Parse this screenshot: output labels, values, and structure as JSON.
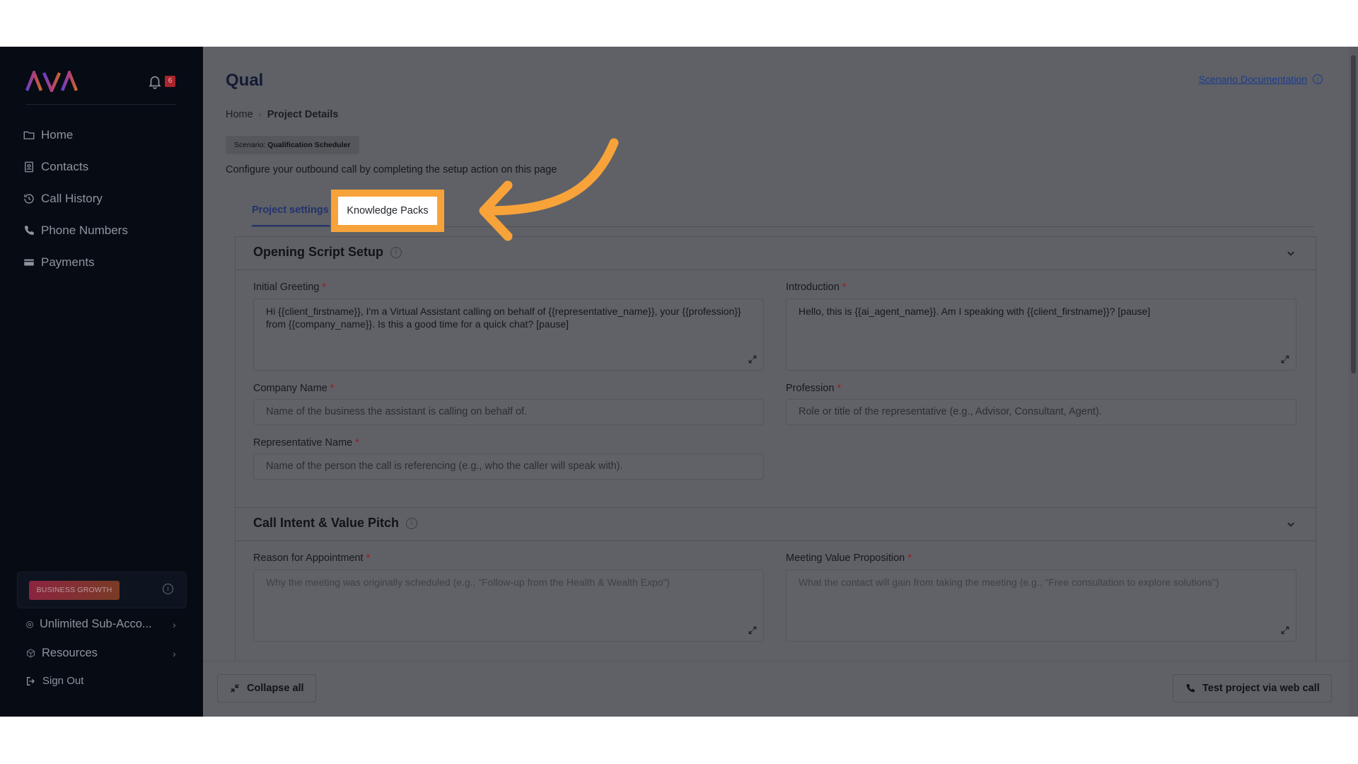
{
  "sidebar": {
    "brand": "AVA",
    "notification_count": "6",
    "nav": [
      {
        "label": "Home",
        "icon": "folder-icon"
      },
      {
        "label": "Contacts",
        "icon": "contacts-icon"
      },
      {
        "label": "Call History",
        "icon": "history-icon"
      },
      {
        "label": "Phone Numbers",
        "icon": "phone-icon"
      },
      {
        "label": "Payments",
        "icon": "card-icon"
      }
    ],
    "plan_badge": "BUSINESS GROWTH",
    "sub_account": "Unlimited Sub-Acco...",
    "resources": "Resources",
    "sign_out": "Sign Out"
  },
  "header": {
    "title": "Qual",
    "doc_link": "Scenario Documentation"
  },
  "breadcrumb": {
    "home": "Home",
    "current": "Project Details"
  },
  "scenario": {
    "prefix": "Scenario:",
    "name": "Qualification Scheduler"
  },
  "configure_text": "Configure your outbound call by completing the setup action on this page",
  "tabs": {
    "project_settings": "Project settings",
    "knowledge_packs": "Knowledge Packs"
  },
  "opening_script": {
    "title": "Opening Script Setup",
    "initial_greeting_label": "Initial Greeting",
    "initial_greeting_value": "Hi {{client_firstname}}, I'm a Virtual Assistant calling on behalf of {{representative_name}}, your {{profession}} from {{company_name}}. Is this a good time for a quick chat? [pause]",
    "introduction_label": "Introduction",
    "introduction_value": "Hello, this is {{ai_agent_name}}. Am I speaking with {{client_firstname}}? [pause]",
    "company_name_label": "Company Name",
    "company_name_placeholder": "Name of the business the assistant is calling on behalf of.",
    "profession_label": "Profession",
    "profession_placeholder": "Role or title of the representative (e.g., Advisor, Consultant, Agent).",
    "representative_label": "Representative Name",
    "representative_placeholder": "Name of the person the call is referencing (e.g., who the caller will speak with)."
  },
  "call_intent": {
    "title": "Call Intent & Value Pitch",
    "reason_label": "Reason for Appointment",
    "reason_placeholder": "Why the meeting was originally scheduled (e.g., “Follow-up from the Health & Wealth Expo”)",
    "value_label": "Meeting Value Proposition",
    "value_placeholder": "What the contact will gain from taking the meeting (e.g., “Free consultation to explore solutions”)"
  },
  "footer": {
    "collapse_all": "Collapse all",
    "test_call": "Test project via web call"
  },
  "colors": {
    "sidebar_bg": "#060b14",
    "highlight": "#f7a33a",
    "arrow": "#f7a33a",
    "link": "#1d3b8c"
  }
}
